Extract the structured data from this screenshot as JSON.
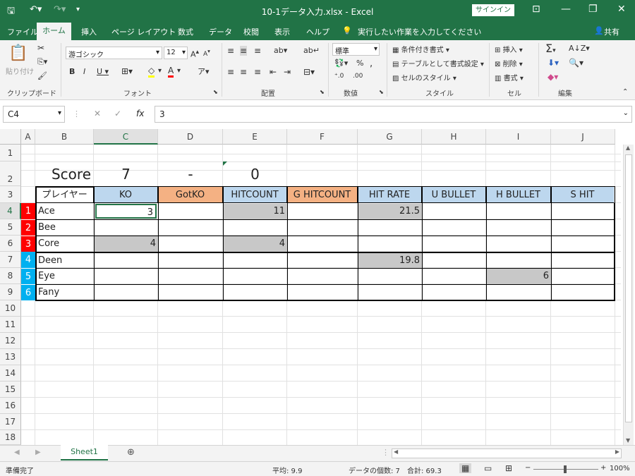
{
  "titlebar": {
    "title": "10-1データ入力.xlsx  -  Excel",
    "signin": "サインイン",
    "save_icon": "save-icon",
    "undo_icon": "undo-icon",
    "redo_icon": "redo-icon"
  },
  "tabs": [
    "ファイル",
    "ホーム",
    "挿入",
    "ページ レイアウト",
    "数式",
    "データ",
    "校閲",
    "表示",
    "ヘルプ"
  ],
  "tell_me": "実行したい作業を入力してください",
  "share": "共有",
  "ribbon": {
    "clipboard": {
      "paste": "貼り付け",
      "label": "クリップボード"
    },
    "font": {
      "name": "游ゴシック",
      "size": "12",
      "label": "フォント"
    },
    "alignment": {
      "label": "配置"
    },
    "number": {
      "format": "標準",
      "label": "数値"
    },
    "styles": {
      "conditional": "条件付き書式",
      "table": "テーブルとして書式設定",
      "cell_styles": "セルのスタイル",
      "label": "スタイル"
    },
    "cells": {
      "insert": "挿入",
      "delete": "削除",
      "format": "書式",
      "label": "セル"
    },
    "editing": {
      "label": "編集"
    }
  },
  "formula_bar": {
    "name_box": "C4",
    "cancel": "✕",
    "enter": "✓",
    "fx": "fx",
    "value": "3"
  },
  "columns": [
    "A",
    "B",
    "C",
    "D",
    "E",
    "F",
    "G",
    "H",
    "I",
    "J"
  ],
  "rows": [
    "1",
    "2",
    "3",
    "4",
    "5",
    "6",
    "7",
    "8",
    "9",
    "10",
    "11",
    "12",
    "13",
    "14",
    "15",
    "16",
    "17",
    "18"
  ],
  "score": {
    "label": "Score",
    "left": "7",
    "sep": "-",
    "right": "0"
  },
  "headers": [
    "プレイヤー",
    "KO",
    "GotKO",
    "HITCOUNT",
    "G HITCOUNT",
    "HIT RATE",
    "U BULLET",
    "H BULLET",
    "S HIT"
  ],
  "players": [
    {
      "num": "1",
      "name": "Ace",
      "color": "#ff0000"
    },
    {
      "num": "2",
      "name": "Bee",
      "color": "#ff0000"
    },
    {
      "num": "3",
      "name": "Core",
      "color": "#ff0000"
    },
    {
      "num": "4",
      "name": "Deen",
      "color": "#00b0f0"
    },
    {
      "num": "5",
      "name": "Eye",
      "color": "#00b0f0"
    },
    {
      "num": "6",
      "name": "Fany",
      "color": "#00b0f0"
    }
  ],
  "values": {
    "c4": "3",
    "e4": "11",
    "g4": "21.5",
    "c6": "4",
    "e6": "4",
    "g7": "19.8",
    "i8": "6"
  },
  "colors": {
    "header_blue": "#bdd7ee",
    "header_orange": "#f4b183",
    "gray_fill": "#c8c8c8",
    "accent": "#217346"
  },
  "sheet_tab": "Sheet1",
  "status": {
    "ready": "準備完了",
    "average": "平均: 9.9",
    "count": "データの個数: 7",
    "sum": "合計: 69.3",
    "zoom": "100%"
  }
}
